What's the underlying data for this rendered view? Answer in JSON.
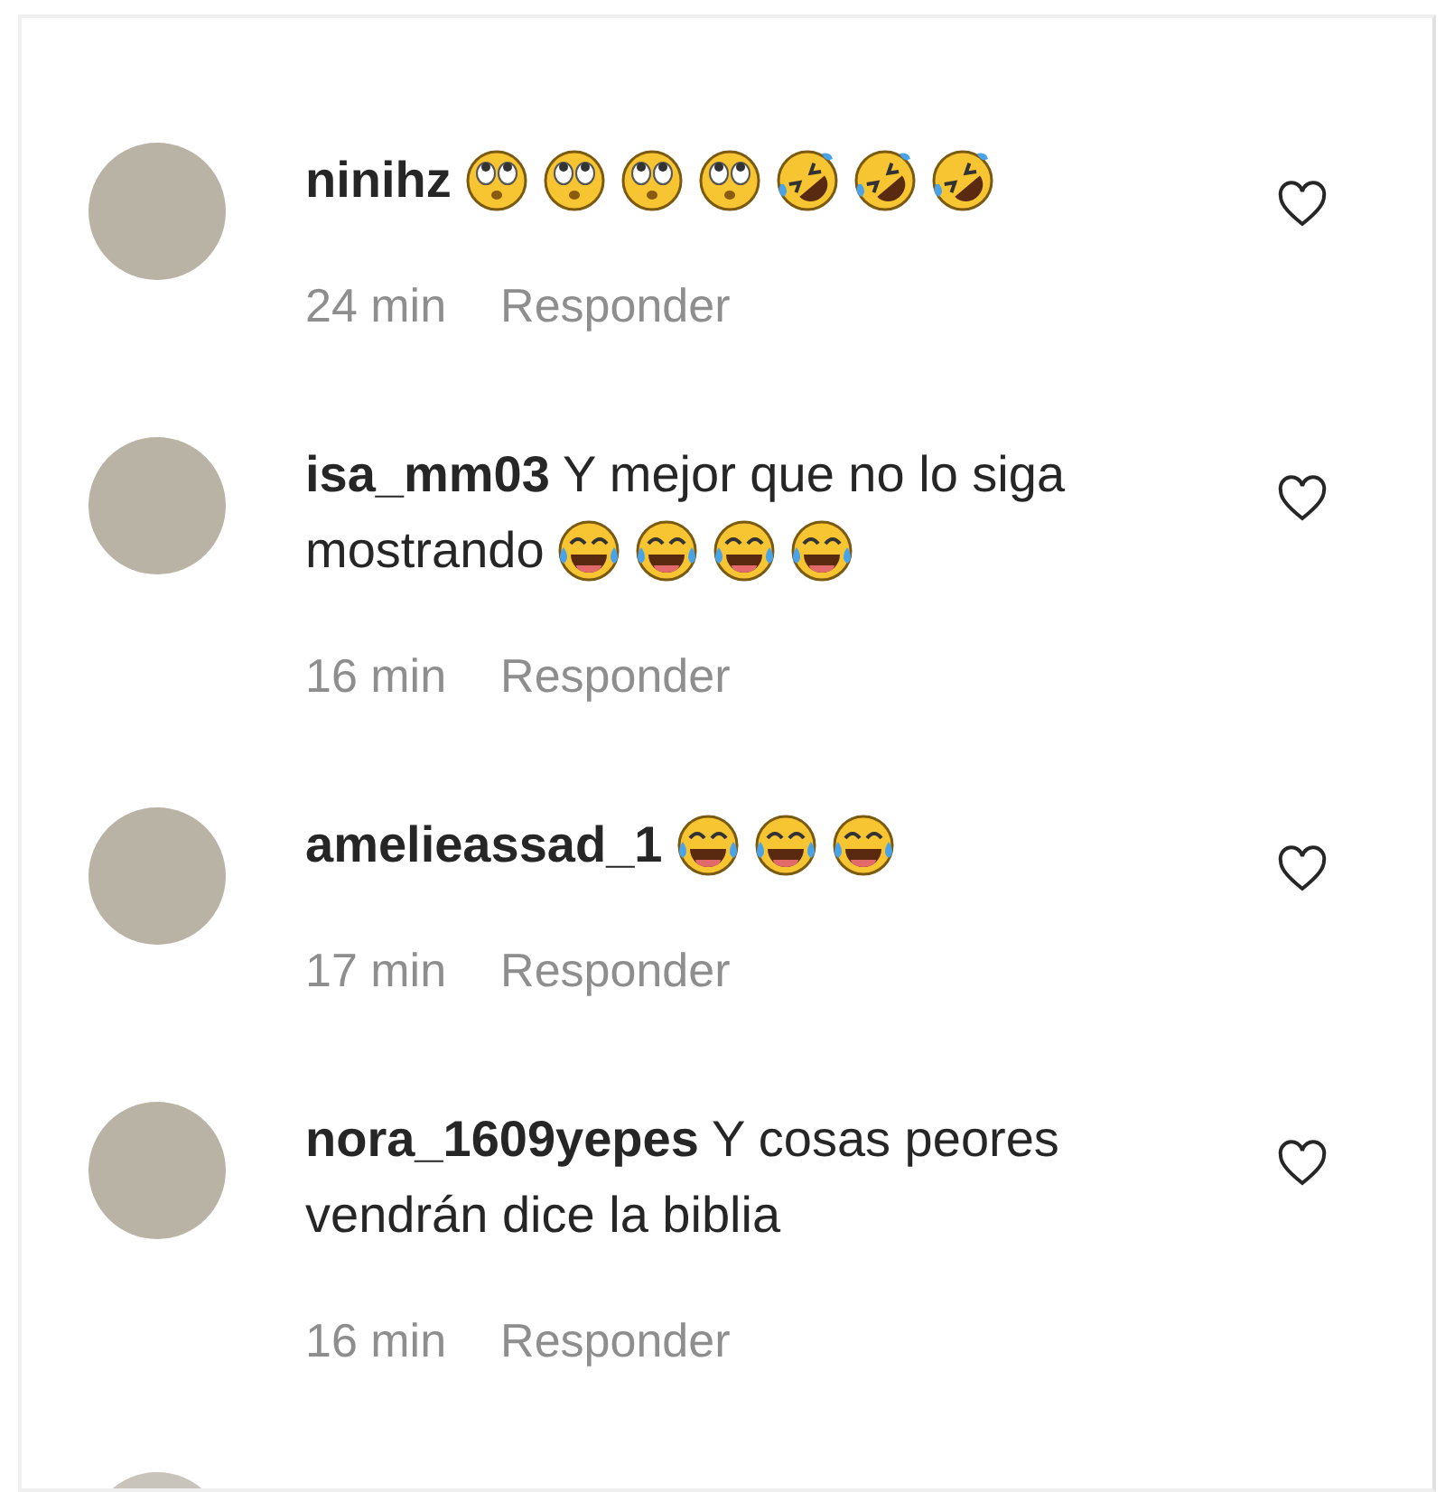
{
  "comments": [
    {
      "username": "ninihz",
      "emojis": [
        {
          "kind": "rolling-eyes"
        },
        {
          "kind": "rolling-eyes"
        },
        {
          "kind": "rolling-eyes"
        },
        {
          "kind": "rolling-eyes"
        },
        {
          "kind": "rolling-laughing"
        },
        {
          "kind": "rolling-laughing"
        },
        {
          "kind": "rolling-laughing"
        }
      ],
      "time": "24 min",
      "reply": "Responder"
    },
    {
      "username": "isa_mm03",
      "text_lines": [
        "Y mejor que no lo siga",
        "mostrando"
      ],
      "emojis": [
        {
          "kind": "tears-of-joy"
        },
        {
          "kind": "tears-of-joy"
        },
        {
          "kind": "tears-of-joy"
        },
        {
          "kind": "tears-of-joy"
        }
      ],
      "time": "16 min",
      "reply": "Responder"
    },
    {
      "username": "amelieassad_1",
      "emojis": [
        {
          "kind": "tears-of-joy"
        },
        {
          "kind": "tears-of-joy"
        },
        {
          "kind": "tears-of-joy"
        }
      ],
      "time": "17 min",
      "reply": "Responder"
    },
    {
      "username": "nora_1609yepes",
      "text_lines": [
        "Y cosas peores",
        "vendrán dice la biblia"
      ],
      "time": "16 min",
      "reply": "Responder"
    }
  ]
}
